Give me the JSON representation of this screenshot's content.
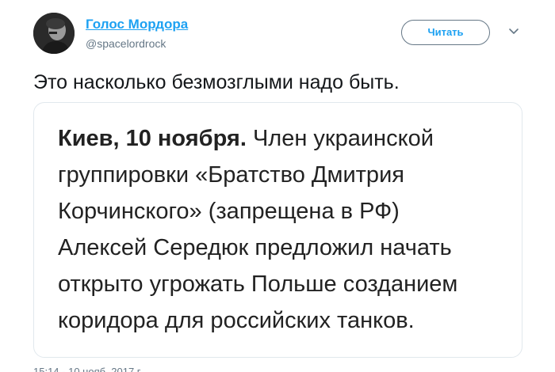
{
  "author": {
    "display_name": "Голос Мордора",
    "handle": "@spacelordrock"
  },
  "actions": {
    "follow_label": "Читать",
    "more_icon": "chevron-down-icon"
  },
  "tweet": {
    "text": "Это насколько безмозглыми надо быть."
  },
  "card": {
    "lead": "Киев, 10 ноября.",
    "line1_rest": " Член украинской",
    "line2": "группировки «Братство Дмитрия",
    "line3": "Корчинского» (запрещена в РФ)",
    "line4": "Алексей Середюк предложил начать",
    "line5": "открыто угрожать Польше созданием",
    "line6": "коридора для российских танков."
  },
  "meta": {
    "timestamp": "15:14 - 10 нояб. 2017 г."
  },
  "colors": {
    "link": "#1da1f2",
    "secondary": "#657786",
    "border": "#e1e8ed"
  }
}
